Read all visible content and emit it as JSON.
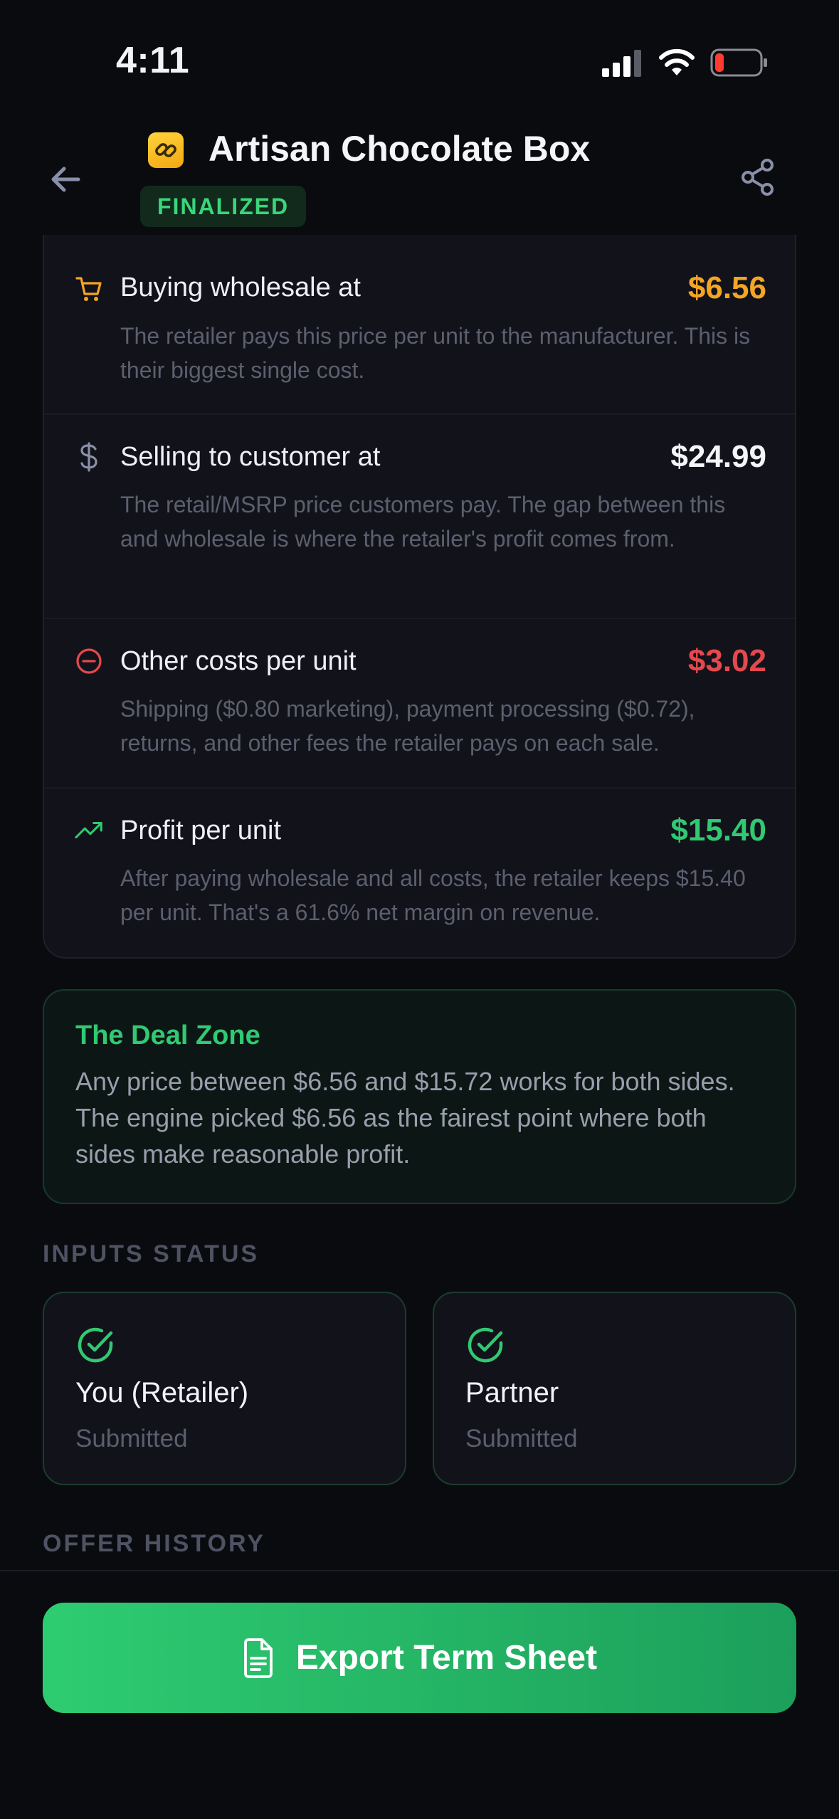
{
  "status_bar": {
    "time": "4:11"
  },
  "header": {
    "title": "Artisan Chocolate Box",
    "badge": "FINALIZED"
  },
  "breakdown": {
    "rows": [
      {
        "icon": "cart-icon",
        "label": "Buying wholesale at",
        "value": "$6.56",
        "value_color": "#f5a524",
        "description": "The retailer pays this price per unit to the manufacturer. This is their biggest single cost."
      },
      {
        "icon": "dollar-icon",
        "label": "Selling to customer at",
        "value": "$24.99",
        "value_color": "#f4f5f8",
        "description": "The retail/MSRP price customers pay. The gap between this and wholesale is where the retailer's profit comes from."
      },
      {
        "icon": "minus-circle-icon",
        "label": "Other costs per unit",
        "value": "$3.02",
        "value_color": "#e5484d",
        "description": "Shipping ($0.80 marketing), payment processing ($0.72), returns, and other fees the retailer pays on each sale."
      },
      {
        "icon": "trending-up-icon",
        "label": "Profit per unit",
        "value": "$15.40",
        "value_color": "#31c972",
        "description": "After paying wholesale and all costs, the retailer keeps $15.40 per unit. That's a 61.6% net margin on revenue."
      }
    ]
  },
  "deal_zone": {
    "title": "The Deal Zone",
    "text": "Any price between $6.56 and $15.72 works for both sides. The engine picked $6.56 as the fairest point where both sides make reasonable profit."
  },
  "inputs_status": {
    "heading": "INPUTS STATUS",
    "cards": [
      {
        "name": "You (Retailer)",
        "status": "Submitted"
      },
      {
        "name": "Partner",
        "status": "Submitted"
      }
    ]
  },
  "offer_history": {
    "heading": "OFFER HISTORY"
  },
  "footer": {
    "export_label": "Export Term Sheet"
  },
  "colors": {
    "accent_green": "#2ecc71",
    "warning_orange": "#f5a524",
    "danger_red": "#e5484d",
    "background": "#0a0b0f"
  }
}
